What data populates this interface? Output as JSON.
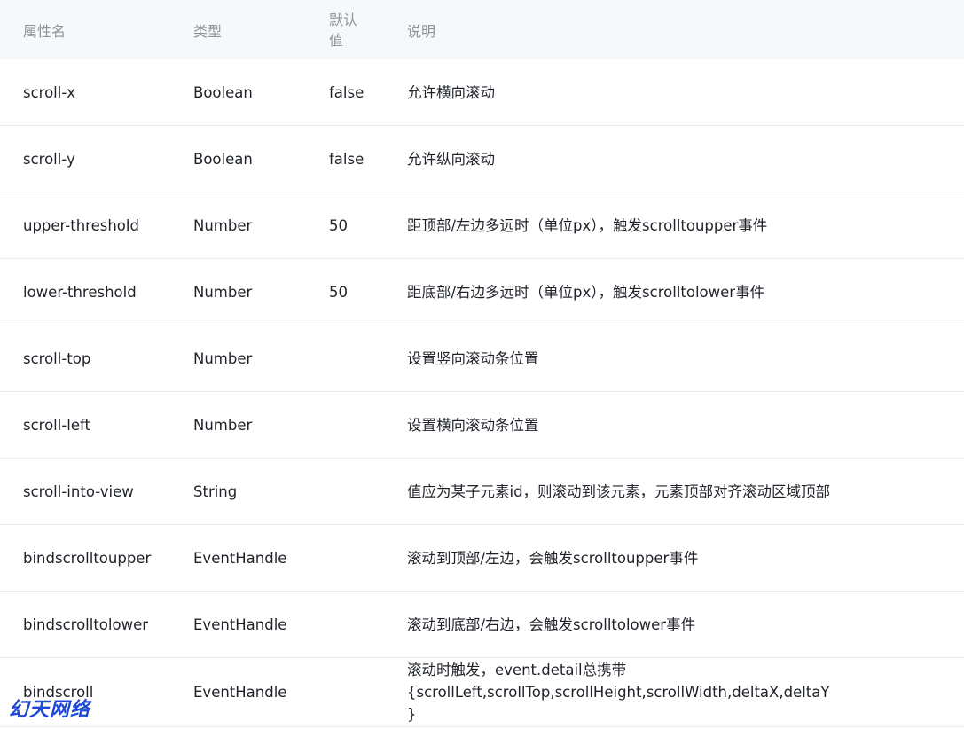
{
  "header": {
    "name": "属性名",
    "type": "类型",
    "default": "默认值",
    "desc": "说明"
  },
  "rows": [
    {
      "name": "scroll-x",
      "type": "Boolean",
      "default": "false",
      "desc": "允许横向滚动"
    },
    {
      "name": "scroll-y",
      "type": "Boolean",
      "default": "false",
      "desc": "允许纵向滚动"
    },
    {
      "name": "upper-threshold",
      "type": "Number",
      "default": "50",
      "desc": "距顶部/左边多远时（单位px），触发scrolltoupper事件"
    },
    {
      "name": "lower-threshold",
      "type": "Number",
      "default": "50",
      "desc": "距底部/右边多远时（单位px），触发scrolltolower事件"
    },
    {
      "name": "scroll-top",
      "type": "Number",
      "default": "",
      "desc": "设置竖向滚动条位置"
    },
    {
      "name": "scroll-left",
      "type": "Number",
      "default": "",
      "desc": "设置横向滚动条位置"
    },
    {
      "name": "scroll-into-view",
      "type": "String",
      "default": "",
      "desc": "值应为某子元素id，则滚动到该元素，元素顶部对齐滚动区域顶部"
    },
    {
      "name": "bindscrolltoupper",
      "type": "EventHandle",
      "default": "",
      "desc": "滚动到顶部/左边，会触发scrolltoupper事件"
    },
    {
      "name": "bindscrolltolower",
      "type": "EventHandle",
      "default": "",
      "desc": "滚动到底部/右边，会触发scrolltolower事件"
    },
    {
      "name": "bindscroll",
      "type": "EventHandle",
      "default": "",
      "desc": "滚动时触发，event.detail总携带{scrollLeft,scrollTop,scrollHeight,scrollWidth,deltaX,deltaY}"
    }
  ],
  "watermark": "幻天网络"
}
